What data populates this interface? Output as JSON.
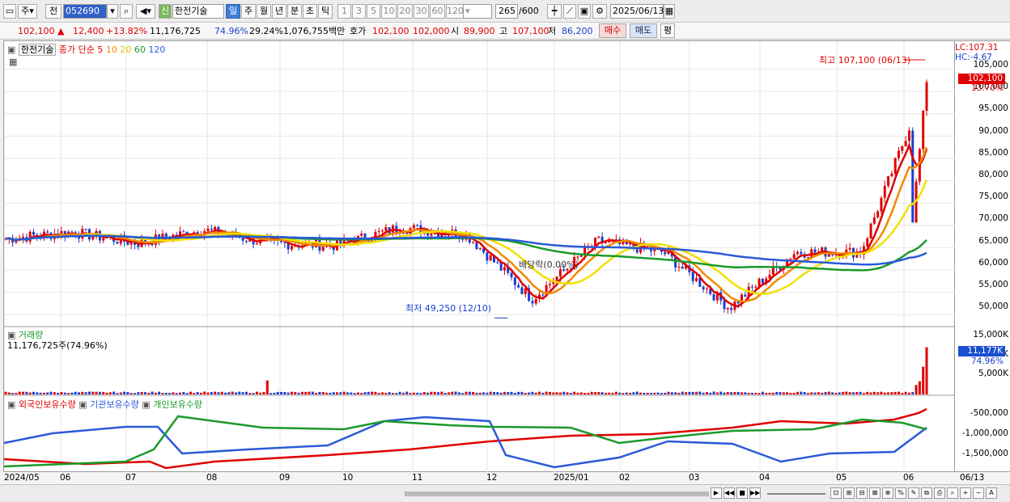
{
  "toolbar": {
    "market_type": "주",
    "prev_label": "전",
    "code": "052690",
    "credit_badge": "신",
    "name": "한전기술",
    "periods": [
      "일",
      "주",
      "월",
      "년",
      "분",
      "초",
      "틱"
    ],
    "active_period": "일",
    "intervals": [
      "1",
      "3",
      "5",
      "10",
      "20",
      "30",
      "60",
      "120"
    ],
    "count": "265",
    "count_total": "/600",
    "date": "2025/06/13"
  },
  "quote": {
    "price": "102,100",
    "change": "12,400",
    "change_pct": "+13.82%",
    "volume": "11,176,725",
    "turnover_pct": "74.96%",
    "vol_ratio": "29.24%",
    "amount": "1,076,755백만",
    "hoga_label": "호가",
    "ask": "102,100",
    "bid": "102,000",
    "open_label": "시",
    "open": "89,900",
    "high_label": "고",
    "high": "107,100",
    "low_label": "저",
    "low": "86,200",
    "buy_btn": "매수",
    "sell_btn": "매도",
    "eval_btn": "평"
  },
  "price_panel": {
    "name_tag": "한전기술",
    "ma_title": "종가 단순",
    "ma_periods": [
      "5",
      "10",
      "20",
      "60",
      "120"
    ],
    "ma_colors": [
      "#e00000",
      "#f08a00",
      "#f0e000",
      "#1a9a2a",
      "#2a5ad8"
    ],
    "lc_label": "LC:107.31",
    "hc_label": "HC:-4.67",
    "current_tag": "102,100",
    "current_pct": "13.70%",
    "high_annotation": "최고 107,100 (06/13)",
    "low_annotation": "최저 49,250 (12/10)",
    "dividend_annotation": "배당락(0.00%)"
  },
  "volume_panel": {
    "title": "거래량",
    "value": "11,176,725주(74.96%)",
    "current_tag": "11,177K",
    "current_pct": "74.96%"
  },
  "holdings_panel": {
    "legend": [
      "외국인보유수량",
      "기관보유수량",
      "개인보유수량"
    ],
    "legend_colors": [
      "#e00000",
      "#2a5ad8",
      "#1a9a2a"
    ]
  },
  "y_axis_price": [
    "105,000",
    "100,000",
    "95,000",
    "90,000",
    "85,000",
    "80,000",
    "75,000",
    "70,000",
    "65,000",
    "60,000",
    "55,000",
    "50,000"
  ],
  "y_axis_volume": [
    "15,000K",
    "10,000K",
    "5,000K"
  ],
  "y_axis_holdings": [
    "-500,000",
    "-1,000,000",
    "-1,500,000"
  ],
  "x_axis": [
    "2024/05",
    "06",
    "07",
    "08",
    "09",
    "10",
    "11",
    "12",
    "2025/01",
    "02",
    "03",
    "04",
    "05",
    "06"
  ],
  "x_axis_end": "06/13",
  "chart_data": {
    "type": "line",
    "y_range": [
      47500,
      108000
    ],
    "x": [
      "2024/05",
      "06",
      "07",
      "08",
      "09",
      "10",
      "11",
      "12",
      "2025/01",
      "02",
      "03",
      "04",
      "05",
      "06",
      "06/13"
    ],
    "close": [
      67000,
      68500,
      66000,
      69000,
      66000,
      65500,
      69500,
      68000,
      53500,
      66500,
      64000,
      51500,
      64000,
      64000,
      102100
    ],
    "high_point": {
      "date": "06/13",
      "value": 107100
    },
    "low_point": {
      "date": "12/10",
      "value": 49250
    }
  }
}
